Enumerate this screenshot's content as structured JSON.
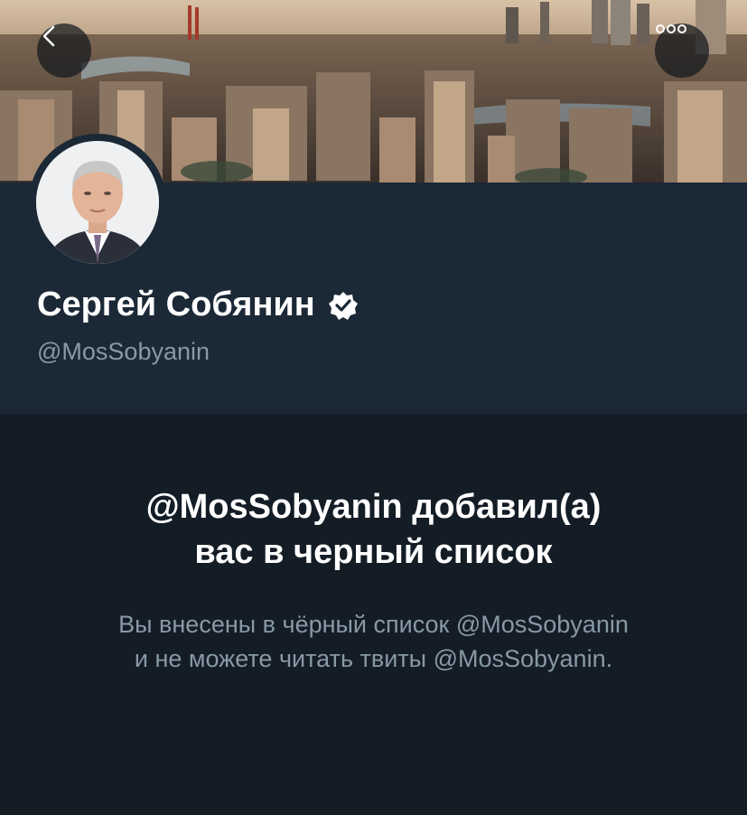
{
  "header": {
    "back_icon": "chevron-left-icon",
    "more_icon": "more-horizontal-icon"
  },
  "profile": {
    "display_name": "Сергей Собянин",
    "verified_icon": "verified-badge-icon",
    "handle": "@MosSobyanin"
  },
  "blocked": {
    "title_line1": "@MosSobyanin добавил(а)",
    "title_line2": "вас в черный список",
    "desc_line1": "Вы внесены в чёрный список @MosSobyanin",
    "desc_line2": "и не можете читать твиты @MosSobyanin."
  },
  "colors": {
    "background": "#141d26",
    "profile_background": "#1b2836",
    "text_primary": "#ffffff",
    "text_secondary": "#8899a6"
  }
}
